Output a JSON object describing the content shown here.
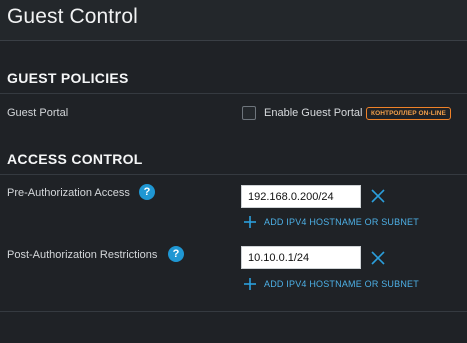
{
  "panel": {
    "title": "Guest Control"
  },
  "guest_policies": {
    "title": "GUEST POLICIES",
    "guest_portal": {
      "label": "Guest Portal",
      "checkbox_label": "Enable Guest Portal",
      "checked": false,
      "badge": "КОНТРОЛЛЕР ON-LINE"
    }
  },
  "access_control": {
    "title": "ACCESS CONTROL",
    "pre_auth": {
      "label": "Pre-Authorization Access",
      "help": "?",
      "value": "192.168.0.200/24",
      "add_label": "ADD IPV4 HOSTNAME OR SUBNET"
    },
    "post_auth": {
      "label": "Post-Authorization Restrictions",
      "help": "?",
      "value": "10.10.0.1/24",
      "add_label": "ADD IPV4 HOSTNAME OR SUBNET"
    }
  },
  "colors": {
    "accent": "#1f97d3",
    "link": "#4db0e6",
    "badge": "#f08228",
    "background": "#1f2226"
  },
  "icons": {
    "help": "question-circle-icon",
    "remove": "close-icon",
    "add": "plus-icon"
  }
}
